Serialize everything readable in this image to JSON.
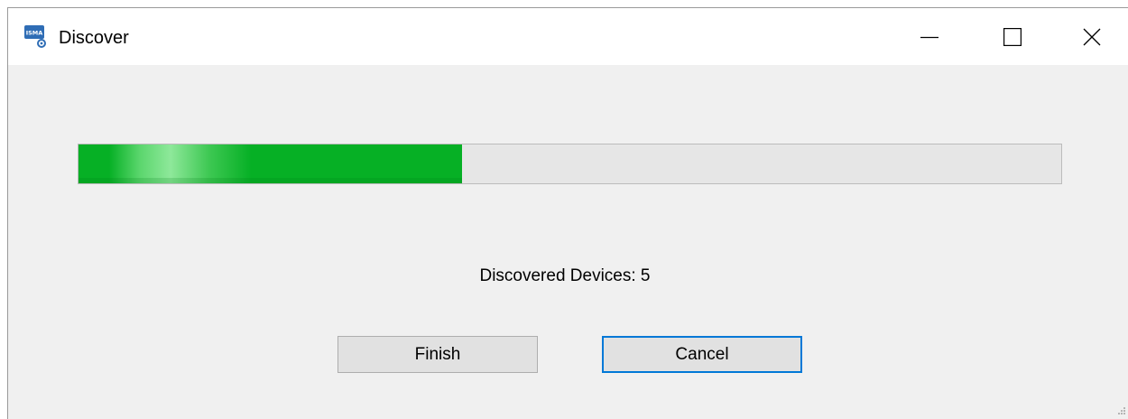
{
  "window": {
    "title": "Discover",
    "icon": "isma-app-icon",
    "icon_text": "ISMA"
  },
  "progress": {
    "value": 0.39
  },
  "status": {
    "text": "Discovered Devices: 5"
  },
  "buttons": {
    "finish_label": "Finish",
    "cancel_label": "Cancel"
  },
  "colors": {
    "progress_fill": "#06b025",
    "focus_border": "#0078d7",
    "window_bg": "#f0f0f0"
  }
}
